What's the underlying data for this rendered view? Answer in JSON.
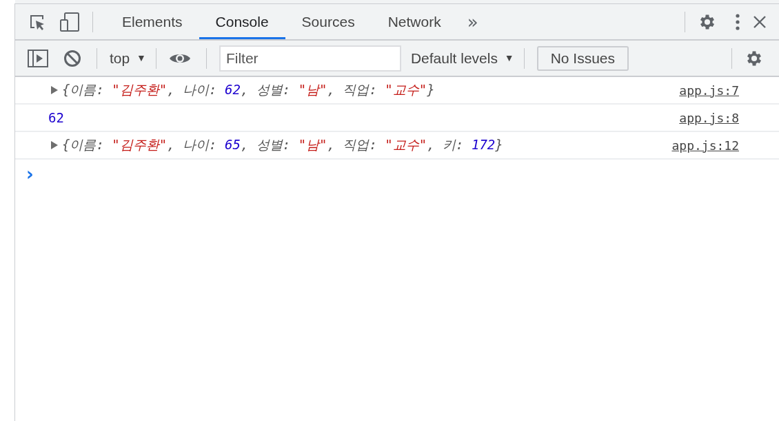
{
  "tabs": [
    {
      "label": "Elements",
      "selected": false
    },
    {
      "label": "Console",
      "selected": true
    },
    {
      "label": "Sources",
      "selected": false
    },
    {
      "label": "Network",
      "selected": false
    }
  ],
  "more_tabs": "»",
  "console_toolbar": {
    "context": {
      "label": "top",
      "arrow": "▼"
    },
    "filter": {
      "placeholder": "Filter"
    },
    "levels": {
      "label": "Default levels",
      "arrow": "▼"
    },
    "issues": "No Issues"
  },
  "messages": [
    {
      "kind": "object",
      "expandable": true,
      "segments": [
        {
          "text": "{이름: ",
          "kind": "plain"
        },
        {
          "text": "\"김주환\"",
          "kind": "string"
        },
        {
          "text": ", 나이: ",
          "kind": "plain"
        },
        {
          "text": "62",
          "kind": "number"
        },
        {
          "text": ", 성별: ",
          "kind": "plain"
        },
        {
          "text": "\"남\"",
          "kind": "string"
        },
        {
          "text": ", 직업: ",
          "kind": "plain"
        },
        {
          "text": "\"교수\"",
          "kind": "string"
        },
        {
          "text": "}",
          "kind": "plain"
        }
      ],
      "source": "app.js:7"
    },
    {
      "kind": "value",
      "segments": [
        {
          "text": "62",
          "kind": "number"
        }
      ],
      "source": "app.js:8"
    },
    {
      "kind": "object",
      "expandable": true,
      "segments": [
        {
          "text": "{이름: ",
          "kind": "plain"
        },
        {
          "text": "\"김주환\"",
          "kind": "string"
        },
        {
          "text": ", 나이: ",
          "kind": "plain"
        },
        {
          "text": "65",
          "kind": "number"
        },
        {
          "text": ", 성별: ",
          "kind": "plain"
        },
        {
          "text": "\"남\"",
          "kind": "string"
        },
        {
          "text": ", 직업: ",
          "kind": "plain"
        },
        {
          "text": "\"교수\"",
          "kind": "string"
        },
        {
          "text": ", 키: ",
          "kind": "plain"
        },
        {
          "text": "172",
          "kind": "number"
        },
        {
          "text": "}",
          "kind": "plain"
        }
      ],
      "source": "app.js:12"
    }
  ],
  "prompt": "›"
}
